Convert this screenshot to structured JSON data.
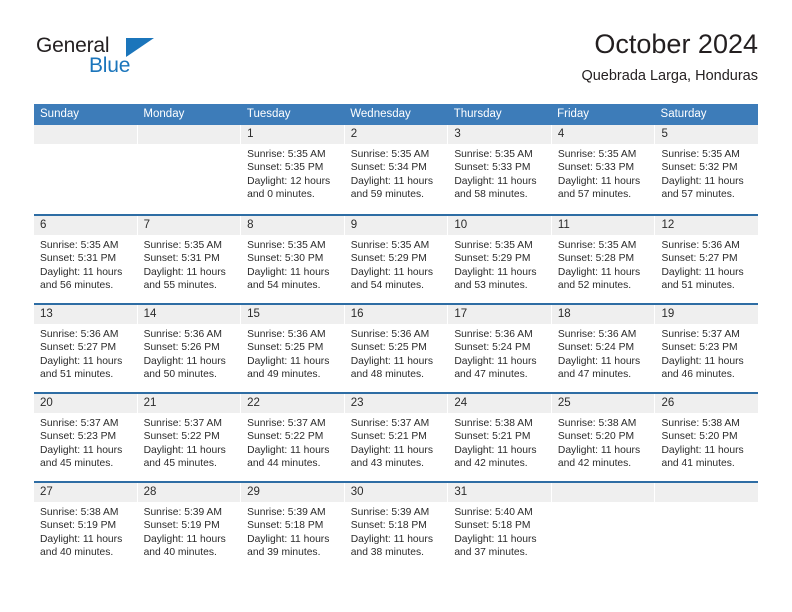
{
  "brand": {
    "word1": "General",
    "word2": "Blue",
    "triangle_color": "#1b75bb"
  },
  "header": {
    "month_title": "October 2024",
    "location": "Quebrada Larga, Honduras"
  },
  "theme": {
    "header_blue": "#3d7cb9",
    "divider_blue": "#2e6da4",
    "band_gray": "#efefef",
    "text": "#2b2b2b"
  },
  "weekdays": [
    "Sunday",
    "Monday",
    "Tuesday",
    "Wednesday",
    "Thursday",
    "Friday",
    "Saturday"
  ],
  "weeks": [
    [
      {
        "day": "",
        "sunrise": "",
        "sunset": "",
        "daylight_line1": "",
        "daylight_line2": ""
      },
      {
        "day": "",
        "sunrise": "",
        "sunset": "",
        "daylight_line1": "",
        "daylight_line2": ""
      },
      {
        "day": "1",
        "sunrise": "Sunrise: 5:35 AM",
        "sunset": "Sunset: 5:35 PM",
        "daylight_line1": "Daylight: 12 hours",
        "daylight_line2": "and 0 minutes."
      },
      {
        "day": "2",
        "sunrise": "Sunrise: 5:35 AM",
        "sunset": "Sunset: 5:34 PM",
        "daylight_line1": "Daylight: 11 hours",
        "daylight_line2": "and 59 minutes."
      },
      {
        "day": "3",
        "sunrise": "Sunrise: 5:35 AM",
        "sunset": "Sunset: 5:33 PM",
        "daylight_line1": "Daylight: 11 hours",
        "daylight_line2": "and 58 minutes."
      },
      {
        "day": "4",
        "sunrise": "Sunrise: 5:35 AM",
        "sunset": "Sunset: 5:33 PM",
        "daylight_line1": "Daylight: 11 hours",
        "daylight_line2": "and 57 minutes."
      },
      {
        "day": "5",
        "sunrise": "Sunrise: 5:35 AM",
        "sunset": "Sunset: 5:32 PM",
        "daylight_line1": "Daylight: 11 hours",
        "daylight_line2": "and 57 minutes."
      }
    ],
    [
      {
        "day": "6",
        "sunrise": "Sunrise: 5:35 AM",
        "sunset": "Sunset: 5:31 PM",
        "daylight_line1": "Daylight: 11 hours",
        "daylight_line2": "and 56 minutes."
      },
      {
        "day": "7",
        "sunrise": "Sunrise: 5:35 AM",
        "sunset": "Sunset: 5:31 PM",
        "daylight_line1": "Daylight: 11 hours",
        "daylight_line2": "and 55 minutes."
      },
      {
        "day": "8",
        "sunrise": "Sunrise: 5:35 AM",
        "sunset": "Sunset: 5:30 PM",
        "daylight_line1": "Daylight: 11 hours",
        "daylight_line2": "and 54 minutes."
      },
      {
        "day": "9",
        "sunrise": "Sunrise: 5:35 AM",
        "sunset": "Sunset: 5:29 PM",
        "daylight_line1": "Daylight: 11 hours",
        "daylight_line2": "and 54 minutes."
      },
      {
        "day": "10",
        "sunrise": "Sunrise: 5:35 AM",
        "sunset": "Sunset: 5:29 PM",
        "daylight_line1": "Daylight: 11 hours",
        "daylight_line2": "and 53 minutes."
      },
      {
        "day": "11",
        "sunrise": "Sunrise: 5:35 AM",
        "sunset": "Sunset: 5:28 PM",
        "daylight_line1": "Daylight: 11 hours",
        "daylight_line2": "and 52 minutes."
      },
      {
        "day": "12",
        "sunrise": "Sunrise: 5:36 AM",
        "sunset": "Sunset: 5:27 PM",
        "daylight_line1": "Daylight: 11 hours",
        "daylight_line2": "and 51 minutes."
      }
    ],
    [
      {
        "day": "13",
        "sunrise": "Sunrise: 5:36 AM",
        "sunset": "Sunset: 5:27 PM",
        "daylight_line1": "Daylight: 11 hours",
        "daylight_line2": "and 51 minutes."
      },
      {
        "day": "14",
        "sunrise": "Sunrise: 5:36 AM",
        "sunset": "Sunset: 5:26 PM",
        "daylight_line1": "Daylight: 11 hours",
        "daylight_line2": "and 50 minutes."
      },
      {
        "day": "15",
        "sunrise": "Sunrise: 5:36 AM",
        "sunset": "Sunset: 5:25 PM",
        "daylight_line1": "Daylight: 11 hours",
        "daylight_line2": "and 49 minutes."
      },
      {
        "day": "16",
        "sunrise": "Sunrise: 5:36 AM",
        "sunset": "Sunset: 5:25 PM",
        "daylight_line1": "Daylight: 11 hours",
        "daylight_line2": "and 48 minutes."
      },
      {
        "day": "17",
        "sunrise": "Sunrise: 5:36 AM",
        "sunset": "Sunset: 5:24 PM",
        "daylight_line1": "Daylight: 11 hours",
        "daylight_line2": "and 47 minutes."
      },
      {
        "day": "18",
        "sunrise": "Sunrise: 5:36 AM",
        "sunset": "Sunset: 5:24 PM",
        "daylight_line1": "Daylight: 11 hours",
        "daylight_line2": "and 47 minutes."
      },
      {
        "day": "19",
        "sunrise": "Sunrise: 5:37 AM",
        "sunset": "Sunset: 5:23 PM",
        "daylight_line1": "Daylight: 11 hours",
        "daylight_line2": "and 46 minutes."
      }
    ],
    [
      {
        "day": "20",
        "sunrise": "Sunrise: 5:37 AM",
        "sunset": "Sunset: 5:23 PM",
        "daylight_line1": "Daylight: 11 hours",
        "daylight_line2": "and 45 minutes."
      },
      {
        "day": "21",
        "sunrise": "Sunrise: 5:37 AM",
        "sunset": "Sunset: 5:22 PM",
        "daylight_line1": "Daylight: 11 hours",
        "daylight_line2": "and 45 minutes."
      },
      {
        "day": "22",
        "sunrise": "Sunrise: 5:37 AM",
        "sunset": "Sunset: 5:22 PM",
        "daylight_line1": "Daylight: 11 hours",
        "daylight_line2": "and 44 minutes."
      },
      {
        "day": "23",
        "sunrise": "Sunrise: 5:37 AM",
        "sunset": "Sunset: 5:21 PM",
        "daylight_line1": "Daylight: 11 hours",
        "daylight_line2": "and 43 minutes."
      },
      {
        "day": "24",
        "sunrise": "Sunrise: 5:38 AM",
        "sunset": "Sunset: 5:21 PM",
        "daylight_line1": "Daylight: 11 hours",
        "daylight_line2": "and 42 minutes."
      },
      {
        "day": "25",
        "sunrise": "Sunrise: 5:38 AM",
        "sunset": "Sunset: 5:20 PM",
        "daylight_line1": "Daylight: 11 hours",
        "daylight_line2": "and 42 minutes."
      },
      {
        "day": "26",
        "sunrise": "Sunrise: 5:38 AM",
        "sunset": "Sunset: 5:20 PM",
        "daylight_line1": "Daylight: 11 hours",
        "daylight_line2": "and 41 minutes."
      }
    ],
    [
      {
        "day": "27",
        "sunrise": "Sunrise: 5:38 AM",
        "sunset": "Sunset: 5:19 PM",
        "daylight_line1": "Daylight: 11 hours",
        "daylight_line2": "and 40 minutes."
      },
      {
        "day": "28",
        "sunrise": "Sunrise: 5:39 AM",
        "sunset": "Sunset: 5:19 PM",
        "daylight_line1": "Daylight: 11 hours",
        "daylight_line2": "and 40 minutes."
      },
      {
        "day": "29",
        "sunrise": "Sunrise: 5:39 AM",
        "sunset": "Sunset: 5:18 PM",
        "daylight_line1": "Daylight: 11 hours",
        "daylight_line2": "and 39 minutes."
      },
      {
        "day": "30",
        "sunrise": "Sunrise: 5:39 AM",
        "sunset": "Sunset: 5:18 PM",
        "daylight_line1": "Daylight: 11 hours",
        "daylight_line2": "and 38 minutes."
      },
      {
        "day": "31",
        "sunrise": "Sunrise: 5:40 AM",
        "sunset": "Sunset: 5:18 PM",
        "daylight_line1": "Daylight: 11 hours",
        "daylight_line2": "and 37 minutes."
      },
      {
        "day": "",
        "sunrise": "",
        "sunset": "",
        "daylight_line1": "",
        "daylight_line2": ""
      },
      {
        "day": "",
        "sunrise": "",
        "sunset": "",
        "daylight_line1": "",
        "daylight_line2": ""
      }
    ]
  ]
}
